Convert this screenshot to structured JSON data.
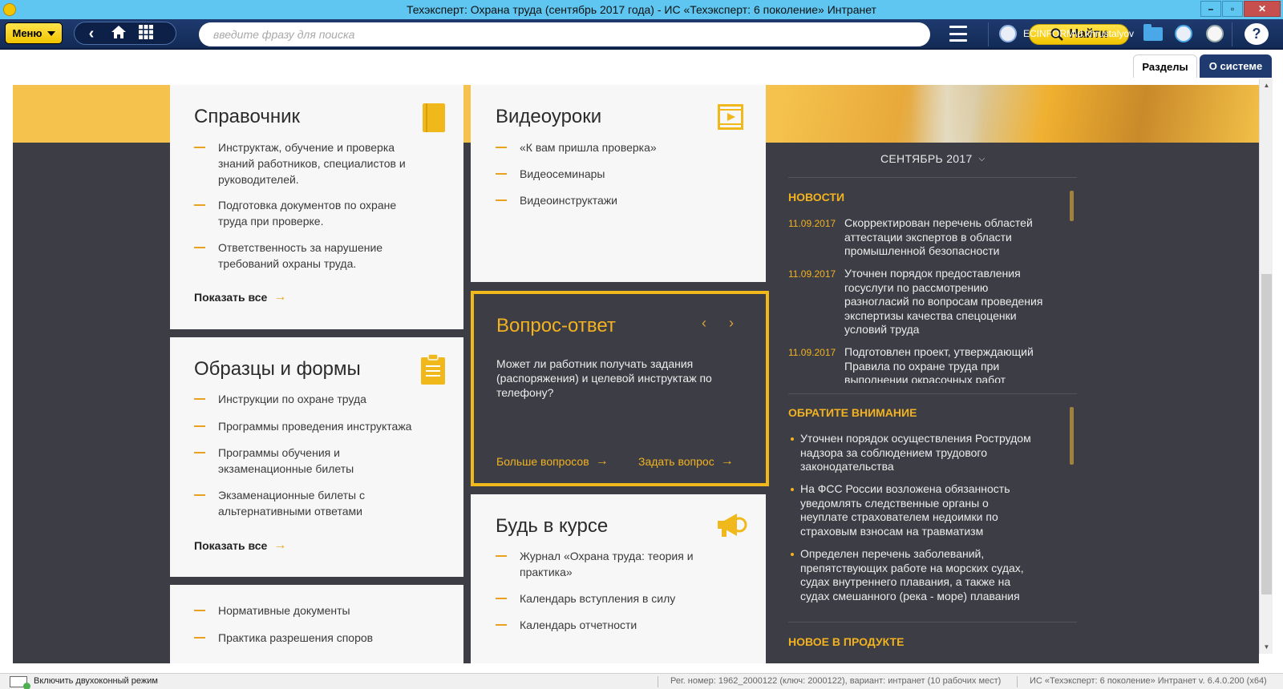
{
  "window": {
    "title": "Техэксперт: Охрана труда (сентябрь 2017 года) - ИС «Техэксперт: 6 поколение» Интранет",
    "minimize": "–",
    "maximize": "▫",
    "close": "✕"
  },
  "toolbar": {
    "menu_label": "Меню",
    "search_placeholder": "введите фразу для поиска",
    "search_value": "",
    "find_label": "Найти",
    "user_name": "ECINFORM\\d.khrustalyov",
    "help_label": "?"
  },
  "tabs": [
    {
      "label": "Разделы",
      "active": true
    },
    {
      "label": "О системе",
      "active": false
    }
  ],
  "spravochnik": {
    "title": "Справочник",
    "icon": "book-icon",
    "items": [
      "Инструктаж, обучение и проверка знаний работников, специалистов и руководителей.",
      "Подготовка документов по охране труда при проверке.",
      "Ответственность за нарушение требований охраны труда."
    ],
    "show_all": "Показать все"
  },
  "videouroki": {
    "title": "Видеоуроки",
    "icon": "video-icon",
    "items": [
      "«К вам пришла проверка»",
      "Видеосеминары",
      "Видеоинструктажи"
    ]
  },
  "obraztsy": {
    "title": "Образцы и формы",
    "icon": "clipboard-icon",
    "items": [
      "Инструкции по охране труда",
      "Программы проведения инструктажа",
      "Программы обучения и экзаменационные билеты",
      "Экзаменационные билеты с альтернативными ответами"
    ],
    "show_all": "Показать все"
  },
  "qa": {
    "title": "Вопрос-ответ",
    "prev": "‹",
    "next": "›",
    "question": "Может ли работник получать задания (распоряжения) и целевой инструктаж по телефону?",
    "more_link": "Больше вопросов",
    "ask_link": "Задать вопрос"
  },
  "bud_v_kurse": {
    "title": "Будь в курсе",
    "icon": "megaphone-icon",
    "items": [
      "Журнал «Охрана труда: теория и практика»",
      "Календарь вступления в силу",
      "Календарь отчетности"
    ]
  },
  "normativ": {
    "items": [
      "Нормативные документы",
      "Практика разрешения споров"
    ]
  },
  "right_panel": {
    "month": "СЕНТЯБРЬ 2017",
    "news_heading": "НОВОСТИ",
    "news": [
      {
        "date": "11.09.2017",
        "text": "Скорректирован перечень областей аттестации экспертов в области промышленной безопасности"
      },
      {
        "date": "11.09.2017",
        "text": "Уточнен порядок предоставления госуслуги по рассмотрению разногласий по вопросам проведения экспертизы качества спецоценки условий труда"
      },
      {
        "date": "11.09.2017",
        "text": "Подготовлен проект, утверждающий Правила по охране труда при выполнении окрасочных работ"
      }
    ],
    "attention_heading": "ОБРАТИТЕ ВНИМАНИЕ",
    "attention": [
      "Уточнен порядок осуществления Рострудом надзора за соблюдением трудового законодательства",
      "На ФСС России возложена обязанность уведомлять следственные органы о неуплате страхователем недоимки по страховым взносам на травматизм",
      "Определен перечень заболеваний, препятствующих работе на морских судах, судах внутреннего плавания, а также на судах смешанного (река - море) плавания"
    ],
    "product_heading": "НОВОЕ В ПРОДУКТЕ"
  },
  "statusbar": {
    "dual_window": "Включить двухоконный режим",
    "reg": "Рег. номер: 1962_2000122 (ключ: 2000122), вариант: интранет (10 рабочих мест)",
    "version": "ИС «Техэксперт: 6 поколение» Интранет v. 6.4.0.200 (x64)"
  },
  "colors": {
    "accent": "#f3b21f",
    "dark_bg": "#3c3d45",
    "toolbar": "#1f3a6e",
    "titlebar": "#5ec6f0"
  }
}
